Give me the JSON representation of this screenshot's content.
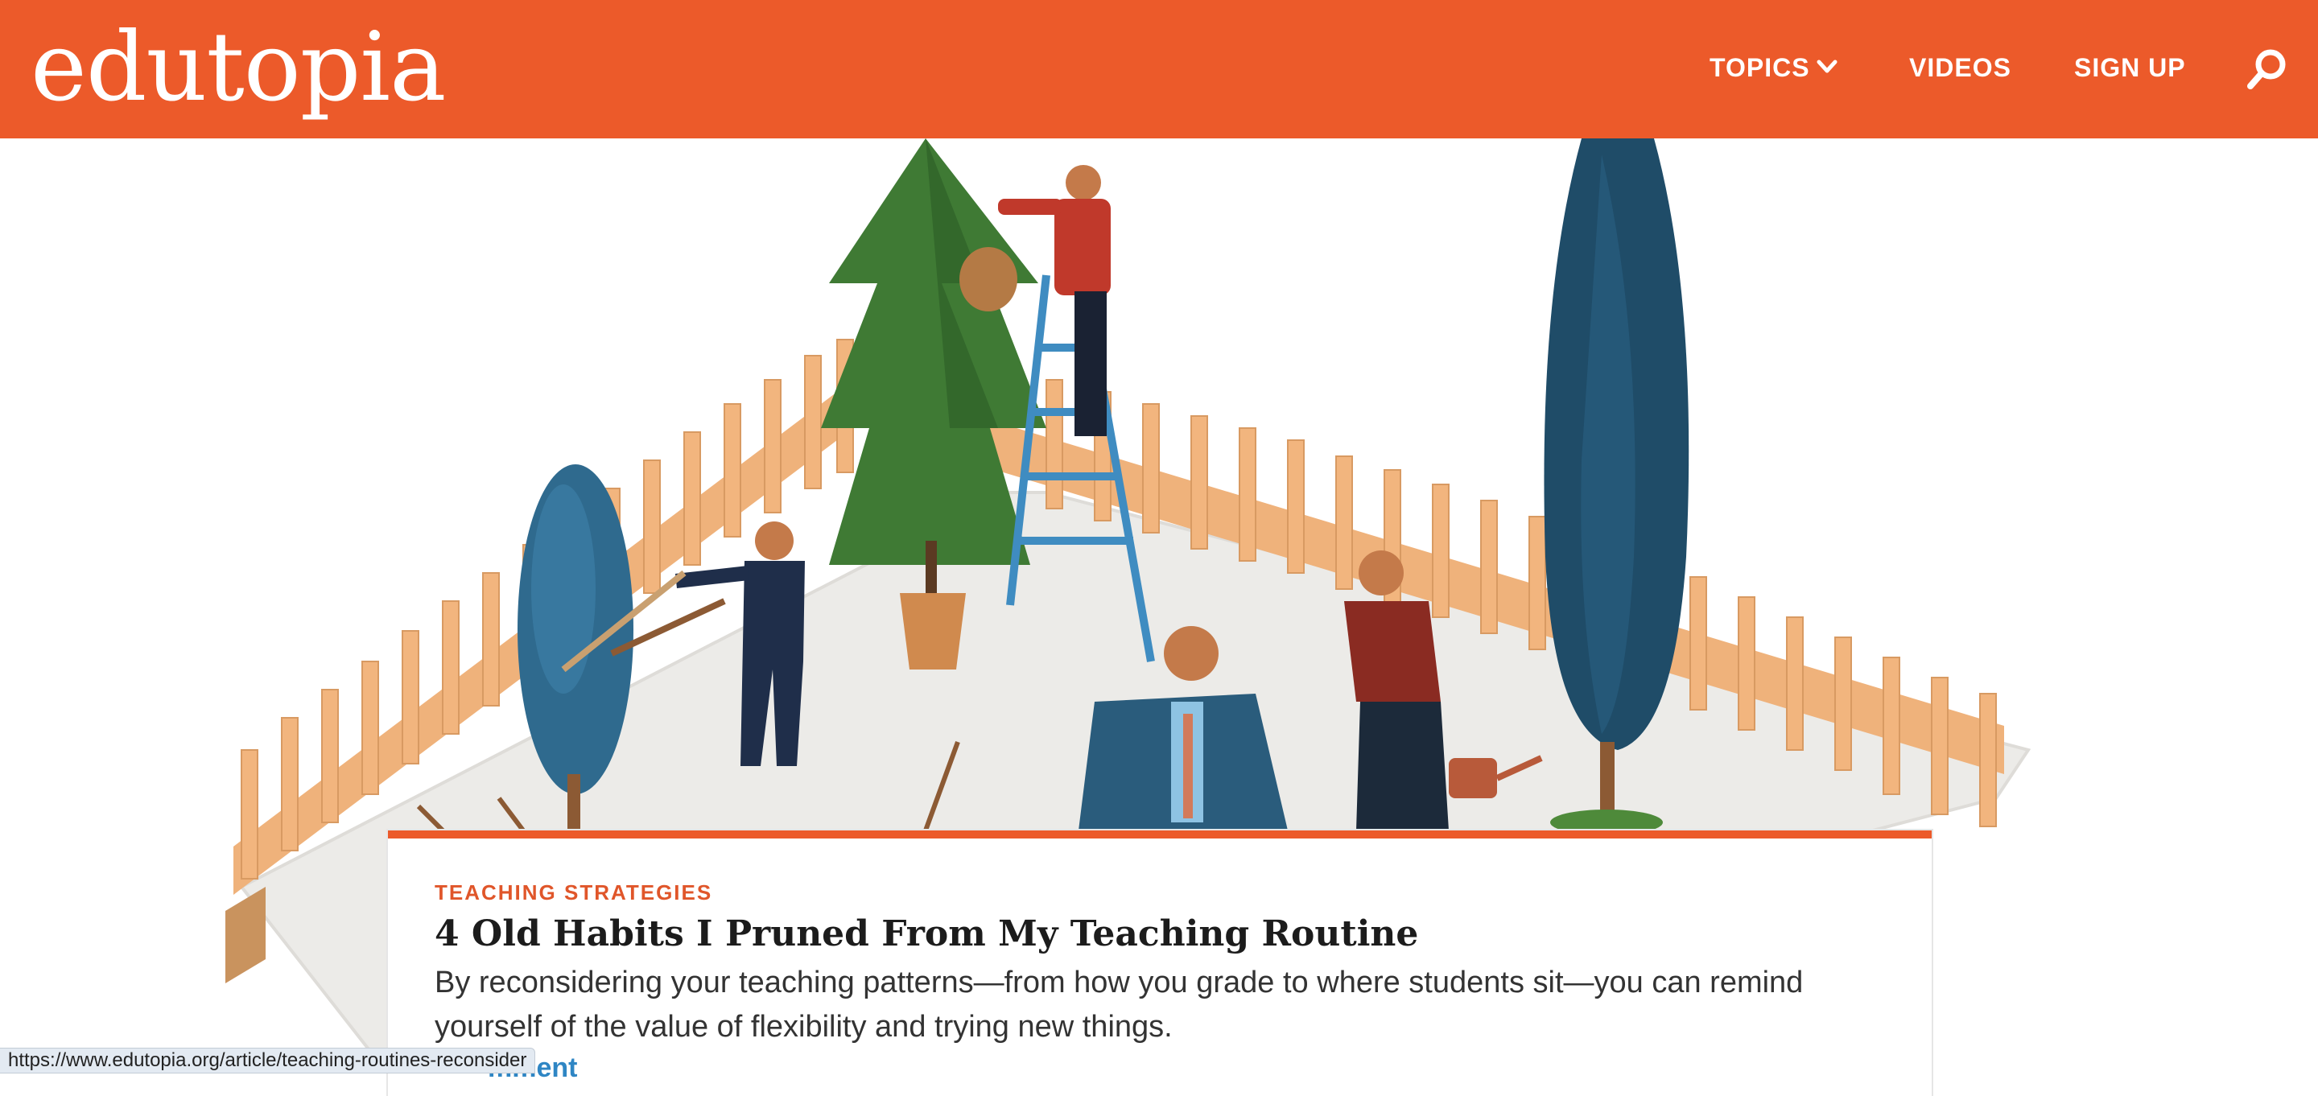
{
  "brand": {
    "logo_text": "edutopia",
    "accent_color": "#ec5a2a"
  },
  "nav": {
    "topics_label": "TOPICS",
    "videos_label": "VIDEOS",
    "signup_label": "SIGN UP",
    "topics_icon": "chevron-down-icon",
    "search_icon": "search-icon"
  },
  "hero": {
    "image_icon": "illustration-garden-pruning"
  },
  "article": {
    "kicker": "TEACHING STRATEGIES",
    "title": "4 Old Habits I Pruned From My Teaching Routine",
    "dek": "By reconsidering your teaching patterns—from how you grade to where students sit—you can remind yourself of the value of flexibility and trying new things.",
    "comment_link_partial": "mment"
  },
  "status_bar": {
    "url": "https://www.edutopia.org/article/teaching-routines-reconsider"
  }
}
